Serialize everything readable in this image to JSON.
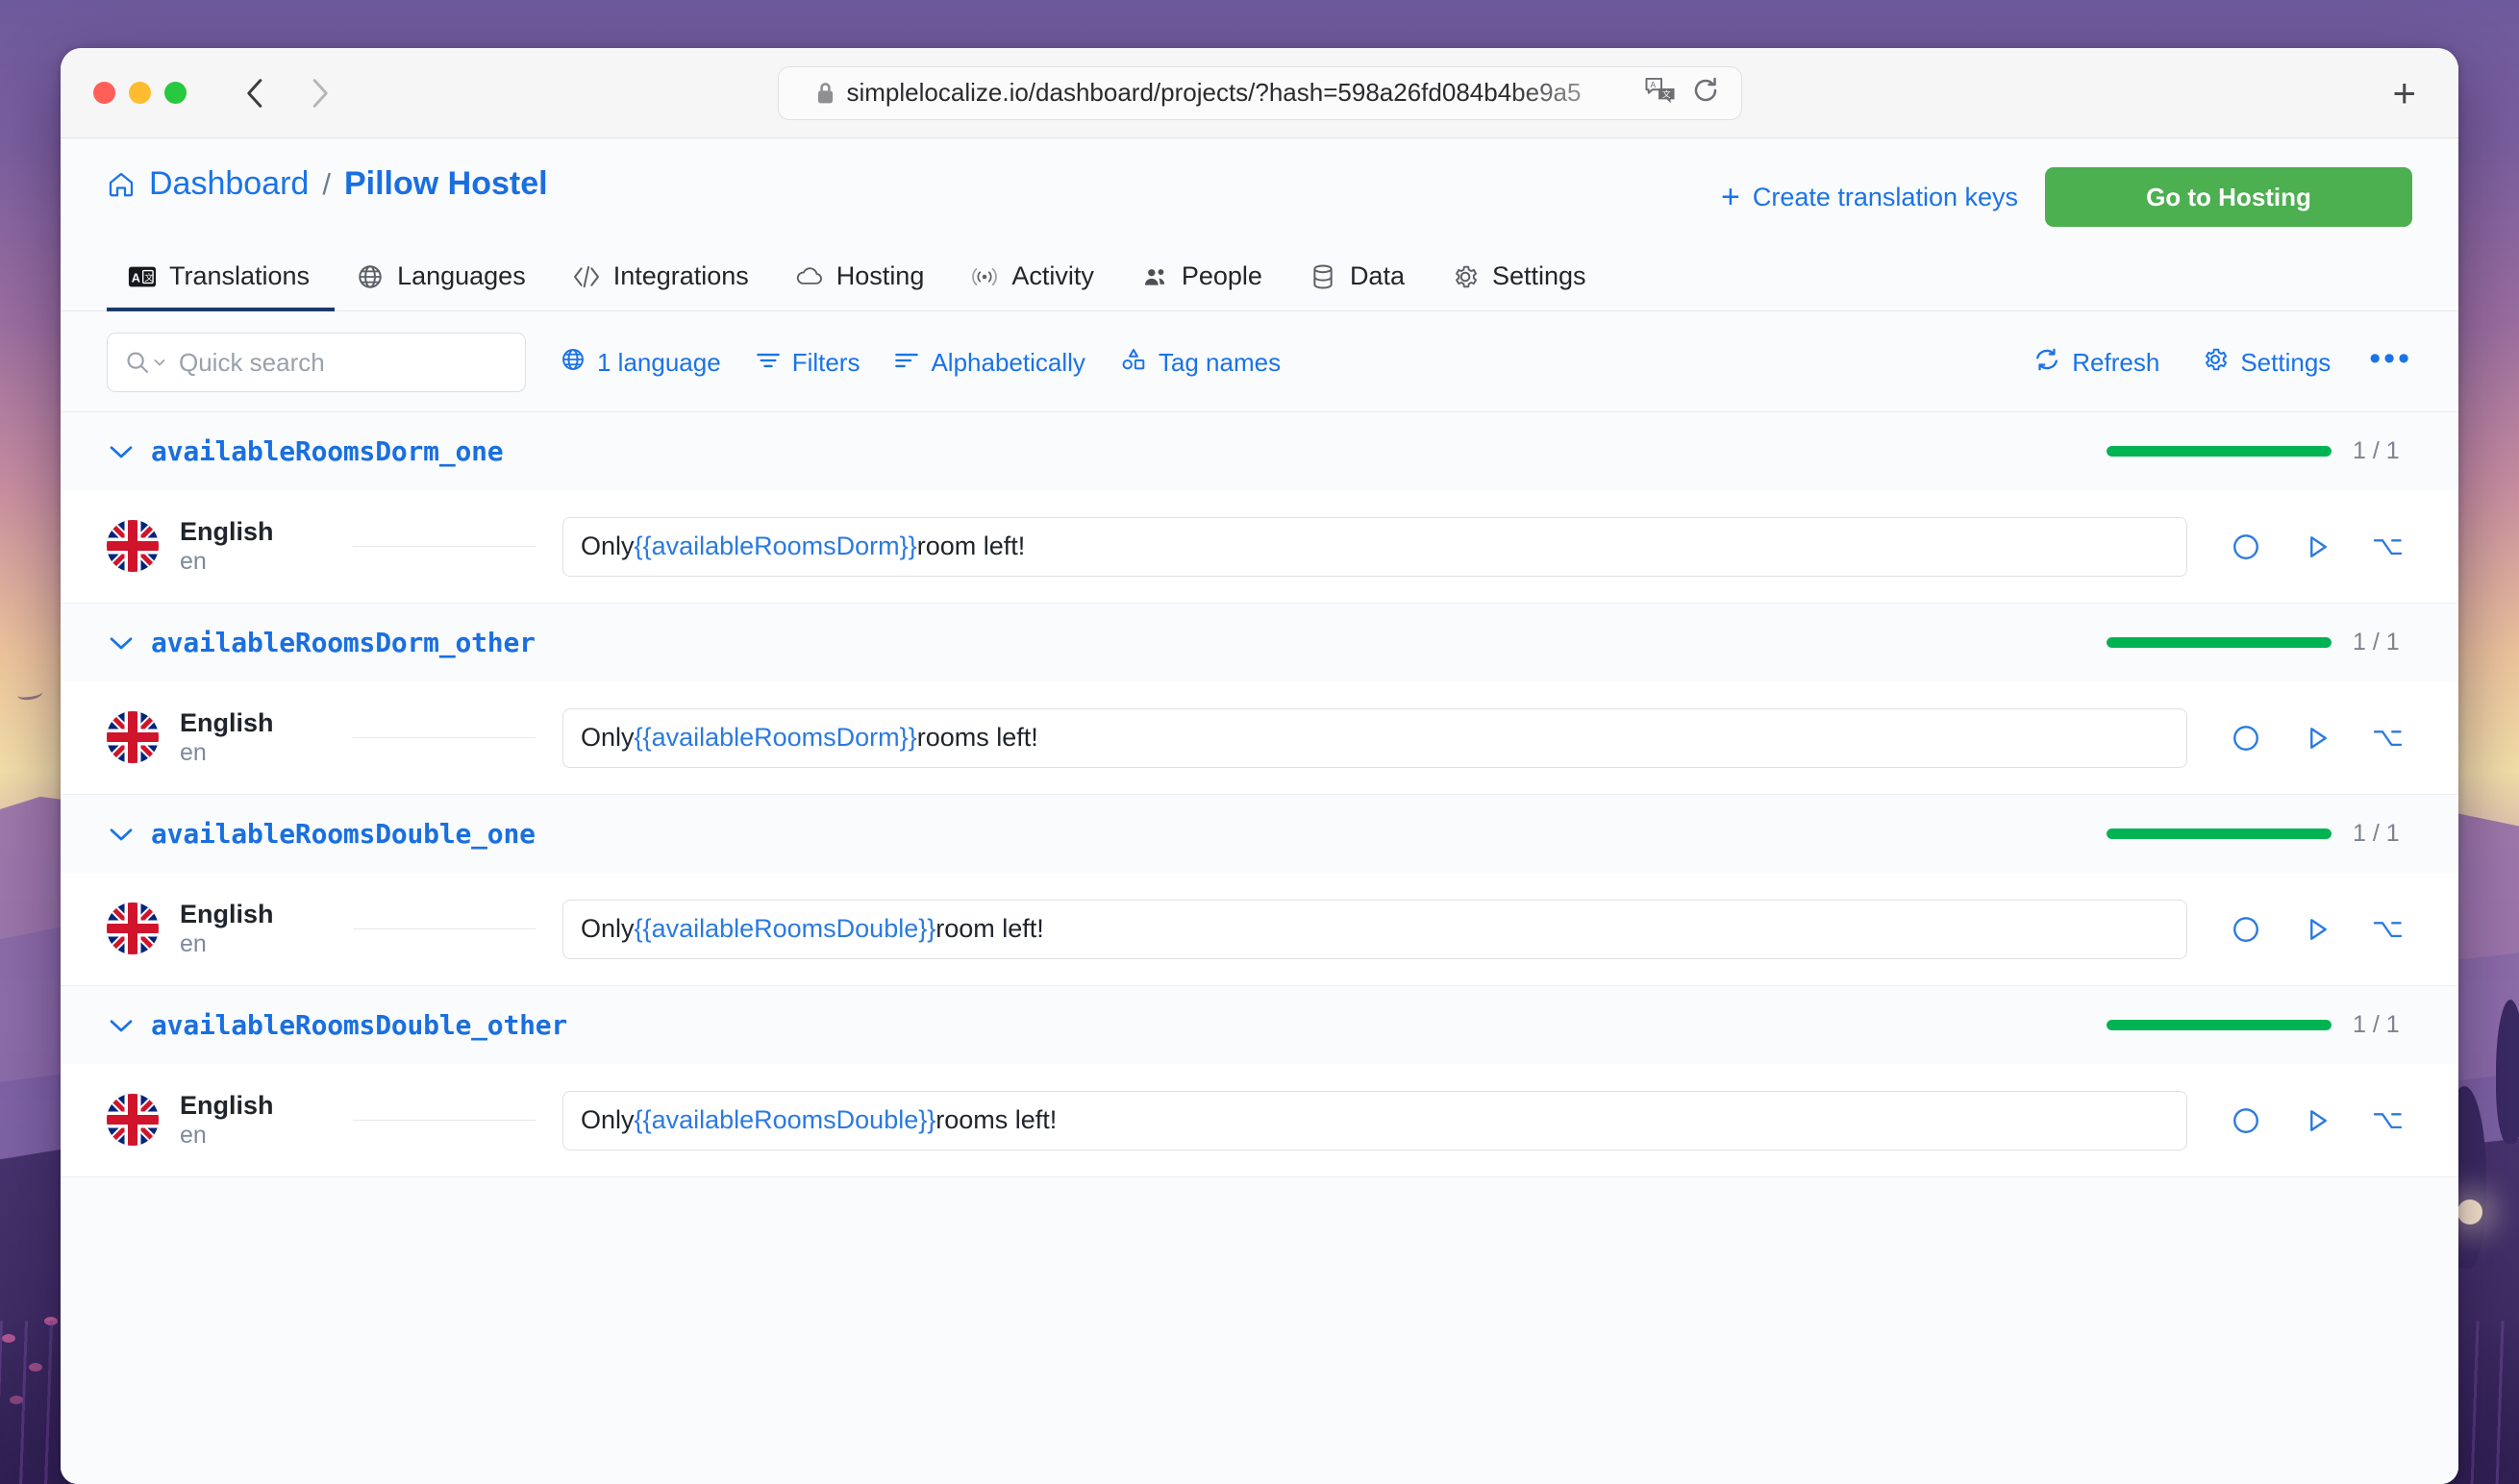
{
  "browser": {
    "url": "simplelocalize.io/dashboard/projects/?hash=598a26fd084b4be9a5",
    "lock_icon": "lock-icon",
    "translate_icon": "translate-page-icon",
    "reload_icon": "reload-icon",
    "new_tab_label": "+",
    "back_icon": "back-arrow-icon",
    "forward_icon": "forward-arrow-icon"
  },
  "header": {
    "home_icon": "home-icon",
    "breadcrumb_root": "Dashboard",
    "breadcrumb_separator": "/",
    "breadcrumb_current": "Pillow Hostel",
    "create_keys_label": "Create translation keys",
    "create_keys_plus": "+",
    "hosting_button": "Go to Hosting",
    "accent_blue": "#1a73e8",
    "hosting_green": "#4caf50"
  },
  "tabs": [
    {
      "label": "Translations",
      "icon": "translate-icon",
      "active": true
    },
    {
      "label": "Languages",
      "icon": "globe-icon",
      "active": false
    },
    {
      "label": "Integrations",
      "icon": "code-icon",
      "active": false
    },
    {
      "label": "Hosting",
      "icon": "cloud-icon",
      "active": false
    },
    {
      "label": "Activity",
      "icon": "broadcast-icon",
      "active": false
    },
    {
      "label": "People",
      "icon": "people-icon",
      "active": false
    },
    {
      "label": "Data",
      "icon": "database-icon",
      "active": false
    },
    {
      "label": "Settings",
      "icon": "gear-icon",
      "active": false
    }
  ],
  "toolbar": {
    "search_placeholder": "Quick search",
    "search_value": "",
    "search_icon": "search-icon",
    "language_filter": "1 language",
    "filters": "Filters",
    "sort": "Alphabetically",
    "tags": "Tag names",
    "refresh": "Refresh",
    "settings": "Settings",
    "more": "•••"
  },
  "rows": [
    {
      "key": "availableRoomsDorm_one",
      "progress_percent": 100,
      "count": "1 / 1",
      "language_name": "English",
      "language_code": "en",
      "value_prefix": "Only ",
      "value_variable": "{{availableRoomsDorm}}",
      "value_suffix": " room left!"
    },
    {
      "key": "availableRoomsDorm_other",
      "progress_percent": 100,
      "count": "1 / 1",
      "language_name": "English",
      "language_code": "en",
      "value_prefix": "Only ",
      "value_variable": "{{availableRoomsDorm}}",
      "value_suffix": " rooms left!"
    },
    {
      "key": "availableRoomsDouble_one",
      "progress_percent": 100,
      "count": "1 / 1",
      "language_name": "English",
      "language_code": "en",
      "value_prefix": "Only ",
      "value_variable": "{{availableRoomsDouble}}",
      "value_suffix": " room left!"
    },
    {
      "key": "availableRoomsDouble_other",
      "progress_percent": 100,
      "count": "1 / 1",
      "language_name": "English",
      "language_code": "en",
      "value_prefix": "Only ",
      "value_variable": "{{availableRoomsDouble}}",
      "value_suffix": " rooms left!"
    }
  ],
  "row_actions": [
    {
      "icon": "circle-status-icon"
    },
    {
      "icon": "play-icon"
    },
    {
      "icon": "option-key-icon"
    }
  ]
}
